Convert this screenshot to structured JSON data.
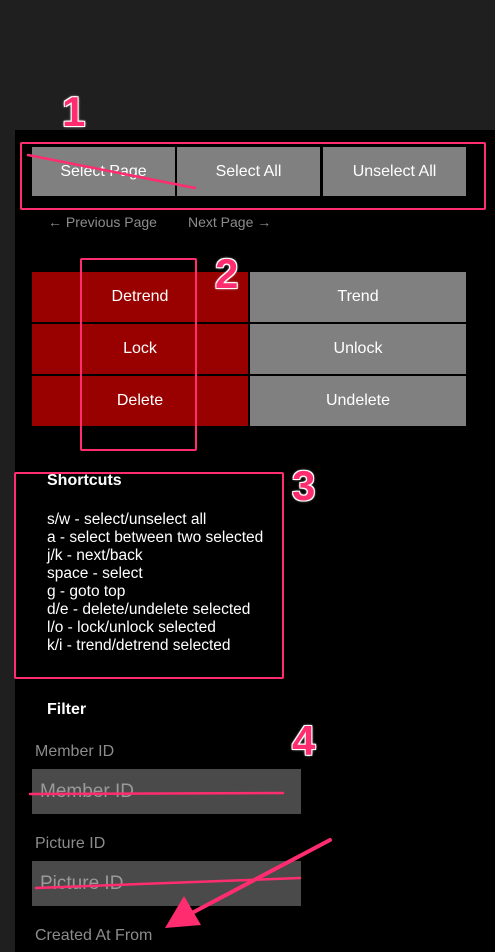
{
  "selection": {
    "select_page": "Select Page",
    "select_all": "Select All",
    "unselect_all": "Unselect All"
  },
  "pagination": {
    "previous": "← Previous Page",
    "next": "Next Page →"
  },
  "actions": {
    "detrend": "Detrend",
    "trend": "Trend",
    "lock": "Lock",
    "unlock": "Unlock",
    "delete": "Delete",
    "undelete": "Undelete"
  },
  "shortcuts": {
    "title": "Shortcuts",
    "lines": [
      "s/w - select/unselect all",
      "a - select between two selected",
      "j/k - next/back",
      "space - select",
      "g - goto top",
      "d/e - delete/undelete selected",
      "l/o - lock/unlock selected",
      "k/i - trend/detrend selected"
    ]
  },
  "filter": {
    "title": "Filter",
    "member_id_label": "Member ID",
    "member_id_placeholder": "Member ID",
    "picture_id_label": "Picture ID",
    "picture_id_placeholder": "Picture ID",
    "created_at_from_label": "Created At From"
  },
  "annotations": [
    "1",
    "2",
    "3",
    "4"
  ],
  "colors": {
    "page_background": "#1f1f1f",
    "panel_background": "#000000",
    "button_gray": "#808080",
    "button_red": "#990000",
    "annotation_pink": "#ff2d6f",
    "input_background": "#4a4a4a"
  }
}
